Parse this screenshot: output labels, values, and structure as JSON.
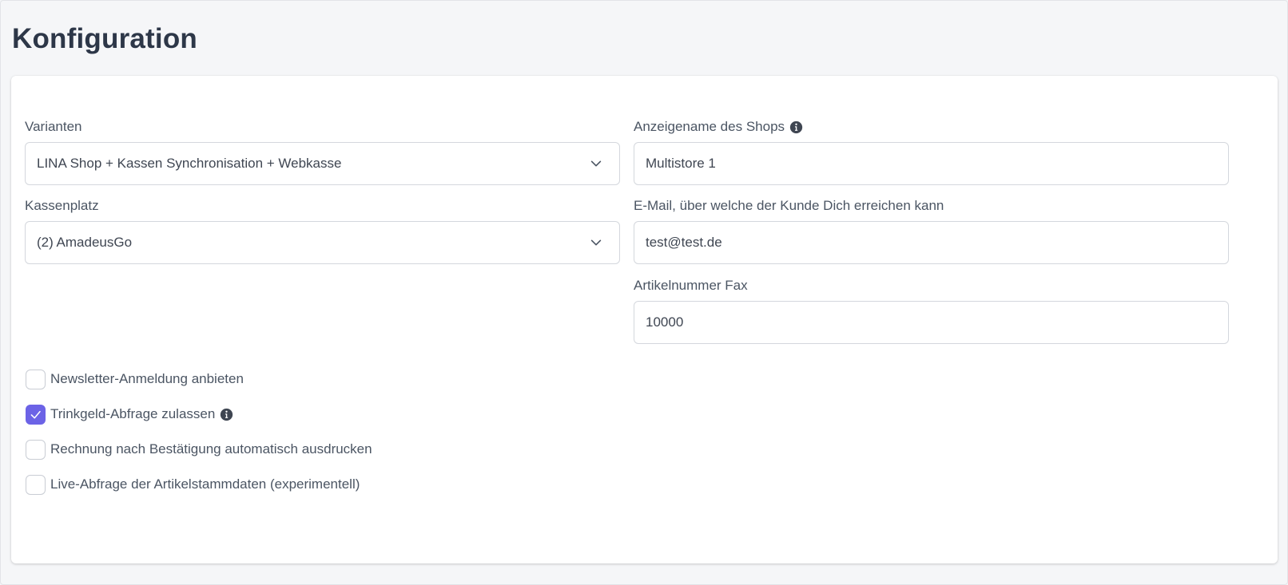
{
  "page": {
    "title": "Konfiguration"
  },
  "form": {
    "varianten": {
      "label": "Varianten",
      "value": "LINA Shop + Kassen Synchronisation + Webkasse"
    },
    "kassenplatz": {
      "label": "Kassenplatz",
      "value": "(2) AmadeusGo"
    },
    "shop_name": {
      "label": "Anzeigename des Shops",
      "value": "Multistore 1"
    },
    "email": {
      "label": "E-Mail, über welche der Kunde Dich erreichen kann",
      "value": "test@test.de"
    },
    "artikelnummer_fax": {
      "label": "Artikelnummer Fax",
      "value": "10000"
    },
    "checkboxes": [
      {
        "label": "Newsletter-Anmeldung anbieten",
        "checked": false
      },
      {
        "label": "Trinkgeld-Abfrage zulassen",
        "checked": true,
        "info": true
      },
      {
        "label": "Rechnung nach Bestätigung automatisch ausdrucken",
        "checked": false
      },
      {
        "label": "Live-Abfrage der Artikelstammdaten (experimentell)",
        "checked": false
      }
    ]
  },
  "colors": {
    "accent": "#6c63e6",
    "text": "#4b5563",
    "title": "#2d3748",
    "border": "#d4d7dd"
  },
  "icons": {
    "select_arrow": "chevron-down-icon",
    "info": "info-icon",
    "check": "check-icon"
  }
}
